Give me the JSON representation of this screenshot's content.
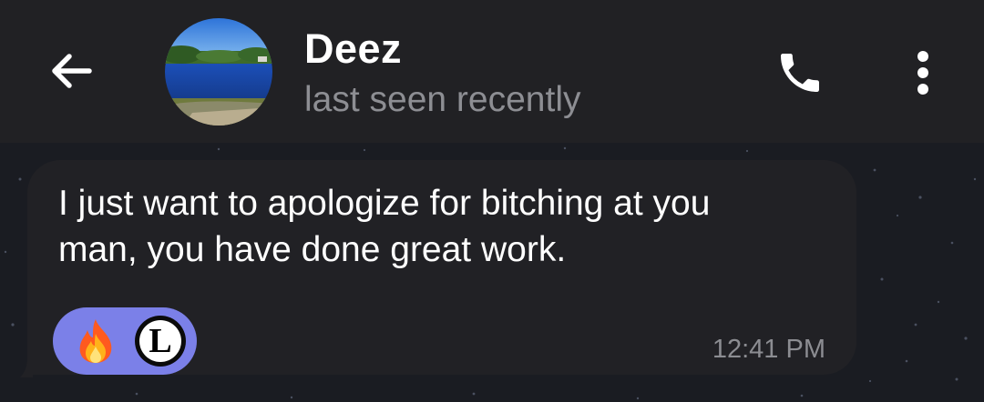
{
  "header": {
    "back_icon": "arrow-left-icon",
    "contact_name": "Deez",
    "status": "last seen recently",
    "call_icon": "phone-icon",
    "menu_icon": "more-vertical-icon"
  },
  "message": {
    "text": "I just want to apologize for bitching at you\nman, you have done great work.",
    "time": "12:41 PM",
    "reactions": {
      "emoji_icon": "fire-emoji-icon",
      "user_initial": "L"
    }
  },
  "colors": {
    "header_bg": "#212124",
    "chat_bg": "#1a1c22",
    "bubble_bg": "#212125",
    "reaction_pill": "#7b80e8",
    "secondary_text": "#8d8e93"
  }
}
